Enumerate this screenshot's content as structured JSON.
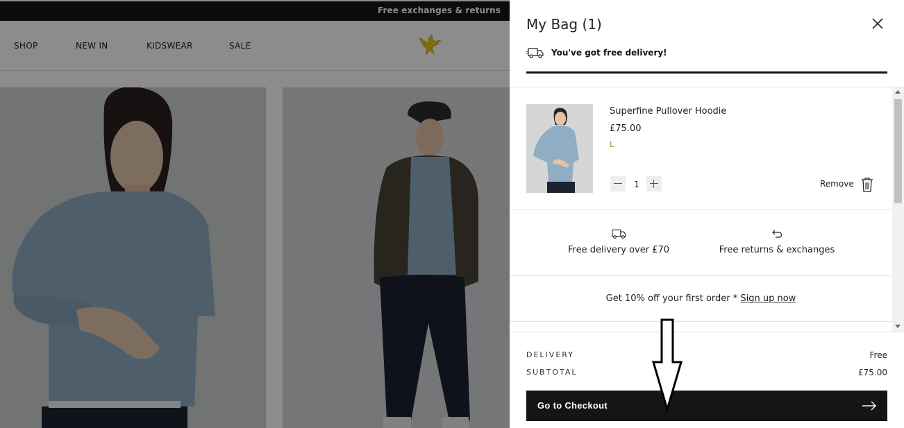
{
  "announcement": "Free exchanges & returns",
  "nav": {
    "items": [
      "SHOP",
      "NEW IN",
      "KIDSWEAR",
      "SALE"
    ]
  },
  "bag": {
    "title": "My Bag (1)",
    "free_delivery_msg": "You've got free delivery!",
    "delivery_progress": 1.0,
    "item": {
      "name": "Superfine Pullover Hoodie",
      "price": "£75.00",
      "size": "L",
      "quantity": "1",
      "remove_label": "Remove"
    },
    "benefits": [
      {
        "icon": "truck-icon",
        "label": "Free delivery over £70"
      },
      {
        "icon": "return-arrow-icon",
        "label": "Free returns & exchanges"
      }
    ],
    "promo_text": "Get 10% off your first order * ",
    "promo_link": "Sign up now",
    "totals": {
      "delivery_label": "DELIVERY",
      "delivery_value": "Free",
      "subtotal_label": "SUBTOTAL",
      "subtotal_value": "£75.00"
    },
    "checkout_label": "Go to Checkout"
  },
  "colors": {
    "accent_dark": "#151515",
    "size_text": "#a89a44",
    "logo": "#e8c51c",
    "hoodie": "#8faec3"
  }
}
